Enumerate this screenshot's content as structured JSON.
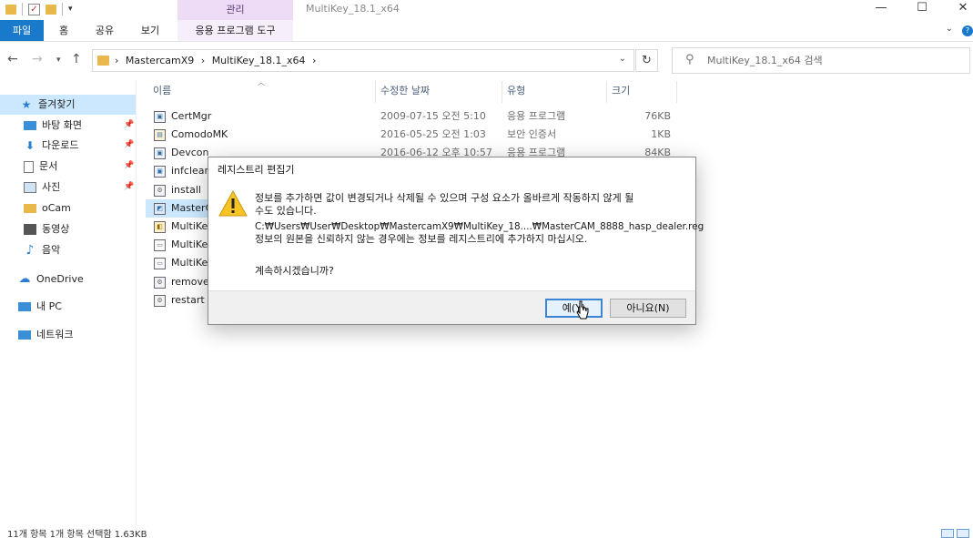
{
  "window": {
    "title": "MultiKey_18.1_x64",
    "manage_tab": "관리"
  },
  "ribbon": {
    "tabs": [
      "파일",
      "홈",
      "공유",
      "보기",
      "응용 프로그램 도구"
    ]
  },
  "address": {
    "crumbs": [
      "MastercamX9",
      "MultiKey_18.1_x64"
    ],
    "separator": "›",
    "search_placeholder": "MultiKey_18.1_x64 검색"
  },
  "sidebar": {
    "items": [
      {
        "label": "즐겨찾기",
        "icon": "star-icon"
      },
      {
        "label": "바탕 화면",
        "icon": "desktop-icon"
      },
      {
        "label": "다운로드",
        "icon": "download-icon"
      },
      {
        "label": "문서",
        "icon": "document-icon"
      },
      {
        "label": "사진",
        "icon": "picture-icon"
      },
      {
        "label": "oCam",
        "icon": "folder-icon"
      },
      {
        "label": "동영상",
        "icon": "video-icon"
      },
      {
        "label": "음악",
        "icon": "music-icon"
      },
      {
        "label": "OneDrive",
        "icon": "cloud-icon"
      },
      {
        "label": "내 PC",
        "icon": "pc-icon"
      },
      {
        "label": "네트워크",
        "icon": "network-icon"
      }
    ]
  },
  "columns": {
    "name": "이름",
    "date": "수정한 날짜",
    "type": "유형",
    "size": "크기"
  },
  "files": [
    {
      "name": "CertMgr",
      "date": "2009-07-15 오전 5:10",
      "type": "응용 프로그램",
      "size": "76KB",
      "icon": "exe-icon"
    },
    {
      "name": "ComodoMK",
      "date": "2016-05-25 오전 1:03",
      "type": "보안 인증서",
      "size": "1KB",
      "icon": "certificate-icon"
    },
    {
      "name": "Devcon",
      "date": "2016-06-12 오후 10:57",
      "type": "응용 프로그램",
      "size": "84KB",
      "icon": "exe-icon"
    },
    {
      "name": "infclean",
      "date": "",
      "type": "",
      "size": "",
      "icon": "exe-icon"
    },
    {
      "name": "install",
      "date": "",
      "type": "",
      "size": "",
      "icon": "batch-icon"
    },
    {
      "name": "MasterC",
      "date": "",
      "type": "",
      "size": "",
      "icon": "registry-icon"
    },
    {
      "name": "MultiKey",
      "date": "",
      "type": "",
      "size": "",
      "icon": "setup-icon"
    },
    {
      "name": "MultiKey",
      "date": "",
      "type": "",
      "size": "",
      "icon": "file-icon"
    },
    {
      "name": "MultiKey",
      "date": "",
      "type": "",
      "size": "",
      "icon": "file-icon"
    },
    {
      "name": "remove",
      "date": "",
      "type": "",
      "size": "",
      "icon": "batch-icon"
    },
    {
      "name": "restart",
      "date": "",
      "type": "",
      "size": "",
      "icon": "batch-icon"
    }
  ],
  "status": {
    "text": "11개 항목    1개 항목 선택함 1.63KB"
  },
  "dialog": {
    "title": "레지스트리 편집기",
    "message_line1": "정보를 추가하면 값이 변경되거나 삭제될 수 있으며 구성 요소가 올바르게 작동하지 않게 될",
    "message_line2": "수도 있습니다.",
    "path": "C:₩Users₩User₩Desktop₩MastercamX9₩MultiKey_18....₩MasterCAM_8888_hasp_dealer.reg",
    "warning": "정보의 원본을 신뢰하지 않는 경우에는 정보를 레지스트리에 추가하지 마십시오.",
    "question": "계속하시겠습니까?",
    "yes_label": "예(Y)",
    "no_label": "아니요(N)"
  }
}
